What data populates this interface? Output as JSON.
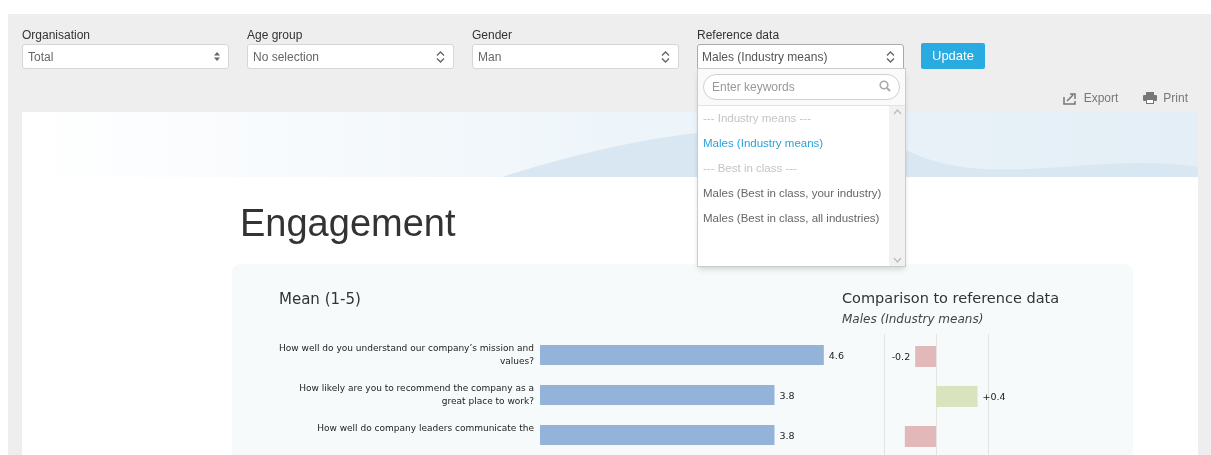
{
  "filters": [
    {
      "label": "Organisation",
      "value": "Total",
      "kind": "small"
    },
    {
      "label": "Age group",
      "value": "No selection",
      "kind": "chevron"
    },
    {
      "label": "Gender",
      "value": "Man",
      "kind": "chevron"
    }
  ],
  "reference": {
    "label": "Reference data",
    "value": "Males (Industry means)",
    "expanded": true,
    "search": {
      "placeholder": "Enter keywords"
    },
    "options": [
      {
        "label": "--- Industry means ---",
        "kind": "group",
        "selected": false
      },
      {
        "label": "Males (Industry means)",
        "kind": "option",
        "selected": true
      },
      {
        "label": "--- Best in class ---",
        "kind": "group",
        "selected": false
      },
      {
        "label": "Males (Best in class, your industry)",
        "kind": "option",
        "selected": false
      },
      {
        "label": "Males (Best in class, all industries)",
        "kind": "option",
        "selected": false
      }
    ]
  },
  "update_button": "Update",
  "actions": [
    {
      "label": "Export",
      "kind": "export"
    },
    {
      "label": "Print",
      "kind": "print"
    }
  ],
  "report": {
    "title": "Engagement",
    "mean": {
      "title": "Mean (1-5)",
      "chart_data": {
        "type": "bar",
        "orientation": "horizontal",
        "categories": [
          "How well do you understand our company’s mission and values?",
          "How likely are you to recommend the company as a great place to work?",
          "How well do company leaders communicate the"
        ],
        "values": [
          4.6,
          3.8,
          3.8
        ],
        "value_labels": [
          "4.6",
          "3.8",
          "3.8"
        ]
      }
    },
    "comparison": {
      "title": "Comparison to reference data",
      "subtitle": "Males (Industry means)",
      "chart_data": {
        "type": "bar",
        "orientation": "horizontal",
        "values": [
          -0.2,
          0.4,
          -0.3
        ],
        "value_labels": [
          "-0.2",
          "+0.4",
          null
        ]
      }
    }
  }
}
